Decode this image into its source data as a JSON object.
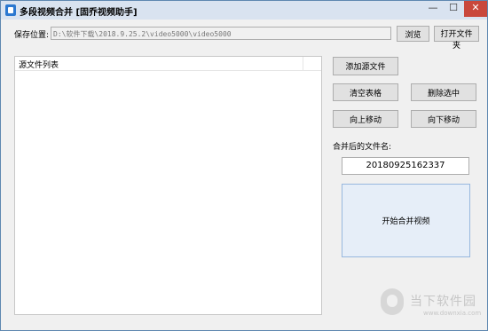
{
  "window": {
    "title": "多段视频合并 [固乔视频助手]",
    "controls": {
      "minimize": "—",
      "maximize": "☐",
      "close": "✕"
    }
  },
  "save": {
    "label": "保存位置:",
    "path": "D:\\软件下载\\2018.9.25.2\\video5000\\video5000",
    "browse_label": "浏览",
    "open_folder_label": "打开文件夹"
  },
  "file_list": {
    "column_header": "源文件列表",
    "rows": []
  },
  "actions": {
    "add_source_label": "添加源文件",
    "clear_table_label": "清空表格",
    "delete_selected_label": "删除选中",
    "move_up_label": "向上移动",
    "move_down_label": "向下移动"
  },
  "output": {
    "label": "合并后的文件名:",
    "filename": "20180925162337"
  },
  "merge": {
    "label": "开始合并视频"
  },
  "watermark": {
    "brand": "当下软件园",
    "url": "www.downxia.com"
  }
}
